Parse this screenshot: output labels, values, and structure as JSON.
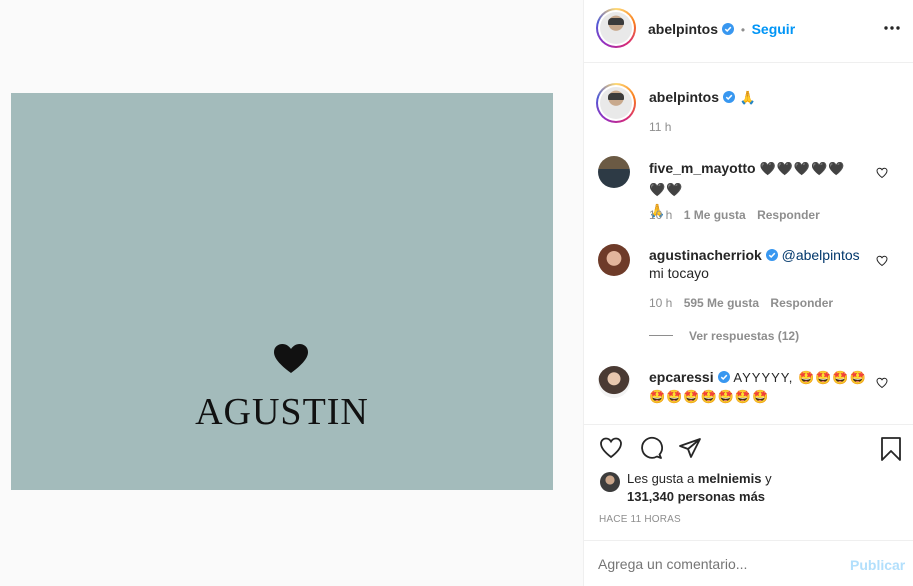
{
  "header": {
    "username": "abelpintos",
    "separator": "•",
    "follow_label": "Seguir",
    "more_icon": "more-horizontal-icon"
  },
  "caption": {
    "username": "abelpintos",
    "emoji": "🙏",
    "time": "11 h"
  },
  "post_image": {
    "word": "AGUSTIN",
    "background_color": "#a3bbbb"
  },
  "comments": [
    {
      "username": "five_m_mayotto",
      "text_line1": "🖤🖤🖤🖤🖤🖤🖤",
      "text_line2": "🙏",
      "time": "10 h",
      "likes": "1 Me gusta",
      "reply": "Responder"
    },
    {
      "username": "agustinacherriok",
      "mention": "@abelpintos",
      "text_line2": "mi tocayo",
      "time": "10 h",
      "likes": "595 Me gusta",
      "reply": "Responder",
      "view_replies": "Ver respuestas (12)"
    },
    {
      "username": "epcaressi",
      "text_line1": "AYYYYY, 🤩🤩🤩🤩",
      "text_line2": "🤩🤩🤩🤩🤩🤩🤩"
    }
  ],
  "likes_summary": {
    "prefix": "Les gusta a",
    "user": "melniemis",
    "conj": "y",
    "count_text": "131,340 personas más"
  },
  "timestamp": "HACE 11 HORAS",
  "add_comment": {
    "placeholder": "Agrega un comentario...",
    "publish_label": "Publicar"
  },
  "colors": {
    "accent": "#0095f6",
    "verified": "#3897f0",
    "muted": "#8e8e8e"
  }
}
